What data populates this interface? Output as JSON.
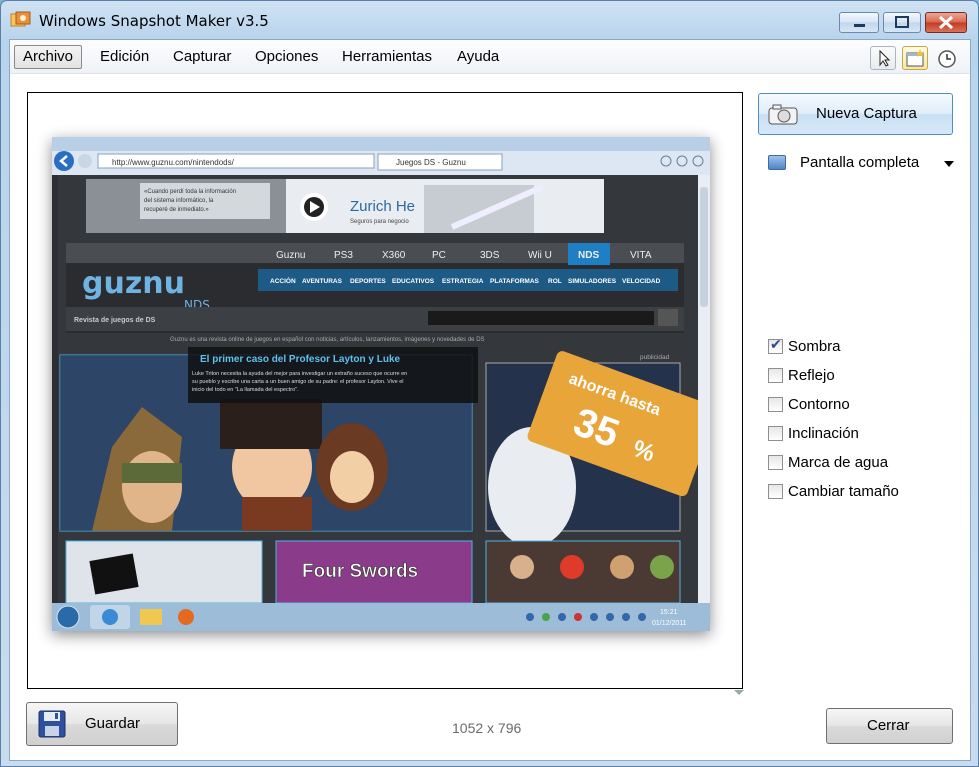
{
  "window": {
    "title": "Windows Snapshot Maker v3.5"
  },
  "menu": {
    "items": [
      "Archivo",
      "Edición",
      "Capturar",
      "Opciones",
      "Herramientas",
      "Ayuda"
    ]
  },
  "toolbar": {
    "icons": [
      "cursor-icon",
      "window-select-icon",
      "clock-icon"
    ]
  },
  "capture": {
    "button_label": "Nueva Captura",
    "mode": "Pantalla completa"
  },
  "options": [
    {
      "label": "Sombra",
      "checked": true
    },
    {
      "label": "Reflejo",
      "checked": false
    },
    {
      "label": "Contorno",
      "checked": false
    },
    {
      "label": "Inclinación",
      "checked": false
    },
    {
      "label": "Marca de agua",
      "checked": false
    },
    {
      "label": "Cambiar tamaño",
      "checked": false
    }
  ],
  "footer": {
    "save_label": "Guardar",
    "dimensions": "1052 x 796",
    "close_label": "Cerrar"
  },
  "preview": {
    "address": "http://www.guznu.com/nintendods/",
    "tab": "Juegos DS - Guznu",
    "ad_text": "Zurich He",
    "ad_sub": "Seguros para negocio",
    "ad_quote": "«Cuando perdí toda la información del sistema informático, la recuperé de inmediato.»",
    "logo": "guznu",
    "logo_sub": "NDS",
    "nav": [
      "Guznu",
      "PS3",
      "X360",
      "PC",
      "3DS",
      "Wii U",
      "NDS",
      "VITA"
    ],
    "subnav": [
      "ACCIÓN",
      "AVENTURAS",
      "DEPORTES",
      "EDUCATIVOS",
      "ESTRATEGIA",
      "PLATAFORMAS",
      "ROL",
      "SIMULADORES",
      "VELOCIDAD"
    ],
    "search_label": "Revista de juegos de DS",
    "tagline": "Guznu es una revista online de juegos en español con noticias, artículos, lanzamientos, imágenes y novedades de DS",
    "feature_title": "El primer caso del Profesor Layton y Luke",
    "feature_text": "Luke Triton necesita la ayuda del mejor para investigar un extraño suceso que ocurre en su pueblo y escribe una carta a un buen amigo de su padre: el profesor Layton. Vive el inicio del todo en \"La llamada del espectro\".",
    "ad_label": "publicidad",
    "promo": "ahorra hasta",
    "promo_value": "35",
    "promo_unit": "%",
    "tile_text": "Four Swords",
    "clock_time": "15:21",
    "clock_date": "01/12/2011"
  }
}
